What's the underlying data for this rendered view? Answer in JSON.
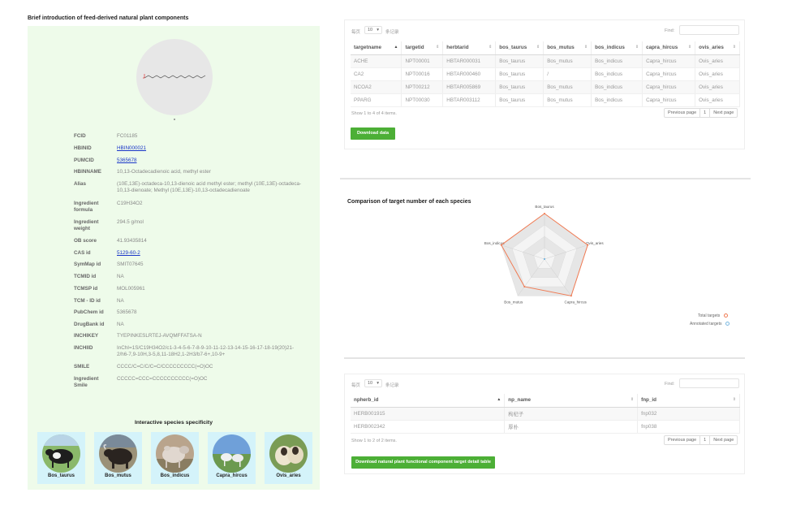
{
  "left": {
    "title": "Brief introduction of feed-derived natural plant components",
    "fields": [
      {
        "label": "FCID",
        "value": "FC01185",
        "link": false
      },
      {
        "label": "HBINID",
        "value": "HBIN000021",
        "link": true
      },
      {
        "label": "PUMCID",
        "value": "5365678",
        "link": true
      },
      {
        "label": "HBINNAME",
        "value": "10,13-Octadecadienoic acid, methyl ester",
        "link": false
      },
      {
        "label": "Alias",
        "value": "(10E,13E)-octadeca-10,13-dienoic acid methyl ester; methyl (10E,13E)-octadeca-10,13-dienoate; Methyl (10E,13E)-10,13-octadecadienoate",
        "link": false
      },
      {
        "label": "Ingredient formula",
        "value": "C19H34O2",
        "link": false
      },
      {
        "label": "Ingredient weight",
        "value": "294.5 g/mol",
        "link": false
      },
      {
        "label": "OB score",
        "value": "41.93435814",
        "link": false
      },
      {
        "label": "CAS id",
        "value": "5129-60-2",
        "link": true
      },
      {
        "label": "SymMap id",
        "value": "SMIT07645",
        "link": false
      },
      {
        "label": "TCMID id",
        "value": "NA",
        "link": false
      },
      {
        "label": "TCMSP id",
        "value": "MOL005961",
        "link": false
      },
      {
        "label": "TCM - ID id",
        "value": "NA",
        "link": false
      },
      {
        "label": "PubChem id",
        "value": "5365678",
        "link": false
      },
      {
        "label": "DrugBank id",
        "value": "NA",
        "link": false
      },
      {
        "label": "INCHIKEY",
        "value": "TYEPINKESLRTEJ-AVQMFFATSA-N",
        "link": false
      },
      {
        "label": "INCHIID",
        "value": "InChI=1S/C19H34O2/c1-3-4-5-6-7-8-9-10-11-12-13-14-15-16-17-18-19(20)21-2/h6-7,9-10H,3-5,8,11-18H2,1-2H3/b7-6+,10-9+",
        "link": false
      },
      {
        "label": "SMILE",
        "value": "CCCC/C=C/C/C=C/CCCCCCCCC(=O)OC",
        "link": false
      },
      {
        "label": "Ingredient Smile",
        "value": "CCCCC=CCC=CCCCCCCCCC(=O)OC",
        "link": false
      }
    ],
    "species_title": "Interactive species specificity",
    "species": [
      "Bos_taurus",
      "Bos_mutus",
      "Bos_indicus",
      "Capra_hircus",
      "Ovis_aries"
    ]
  },
  "table1": {
    "show_prefix": "每页",
    "page_size": "10",
    "show_suffix": "条记录",
    "find_label": "Find:",
    "columns": [
      "targetname",
      "targetid",
      "herbtarid",
      "bos_taurus",
      "bos_mutus",
      "bos_indicus",
      "capra_hircus",
      "ovis_aries"
    ],
    "rows": [
      [
        "ACHE",
        "NPT00001",
        "HBTAR000031",
        "Bos_taurus",
        "Bos_mutus",
        "Bos_indicus",
        "Capra_hircus",
        "Ovis_aries"
      ],
      [
        "CA2",
        "NPT00016",
        "HBTAR000460",
        "Bos_taurus",
        "/",
        "Bos_indicus",
        "Capra_hircus",
        "Ovis_aries"
      ],
      [
        "NCOA2",
        "NPT00212",
        "HBTAR005869",
        "Bos_taurus",
        "Bos_mutus",
        "Bos_indicus",
        "Capra_hircus",
        "Ovis_aries"
      ],
      [
        "PPARG",
        "NPT00030",
        "HBTAR003112",
        "Bos_taurus",
        "Bos_mutus",
        "Bos_indicus",
        "Capra_hircus",
        "Ovis_aries"
      ]
    ],
    "info": "Show 1 to 4 of 4 items.",
    "prev": "Previous page",
    "page": "1",
    "next": "Next page",
    "download": "Download data"
  },
  "chart_data": {
    "type": "radar",
    "title": "Comparison of target number of each species",
    "axes": [
      "Bos_taurus",
      "Ovis_aries",
      "Capra_hircus",
      "Bos_mutus",
      "Bos_indicus"
    ],
    "series": [
      {
        "name": "Total targets",
        "values": [
          4,
          4,
          4,
          3,
          4
        ],
        "color": "#f07a52"
      },
      {
        "name": "Annotated targets",
        "values": [
          0,
          0,
          0,
          0,
          0
        ],
        "color": "#7ab8e0"
      }
    ],
    "max": 4
  },
  "table2": {
    "show_prefix": "每页",
    "page_size": "10",
    "show_suffix": "条记录",
    "find_label": "Find:",
    "columns": [
      "npherb_id",
      "np_name",
      "fnp_id"
    ],
    "rows": [
      [
        "HERB001915",
        "枸杞子",
        "fnp032"
      ],
      [
        "HERB002342",
        "厚朴",
        "fnp038"
      ]
    ],
    "info": "Show 1 to 2 of 2 items.",
    "prev": "Previous page",
    "page": "1",
    "next": "Next page",
    "download": "Download natural plant functional component target detail table"
  }
}
